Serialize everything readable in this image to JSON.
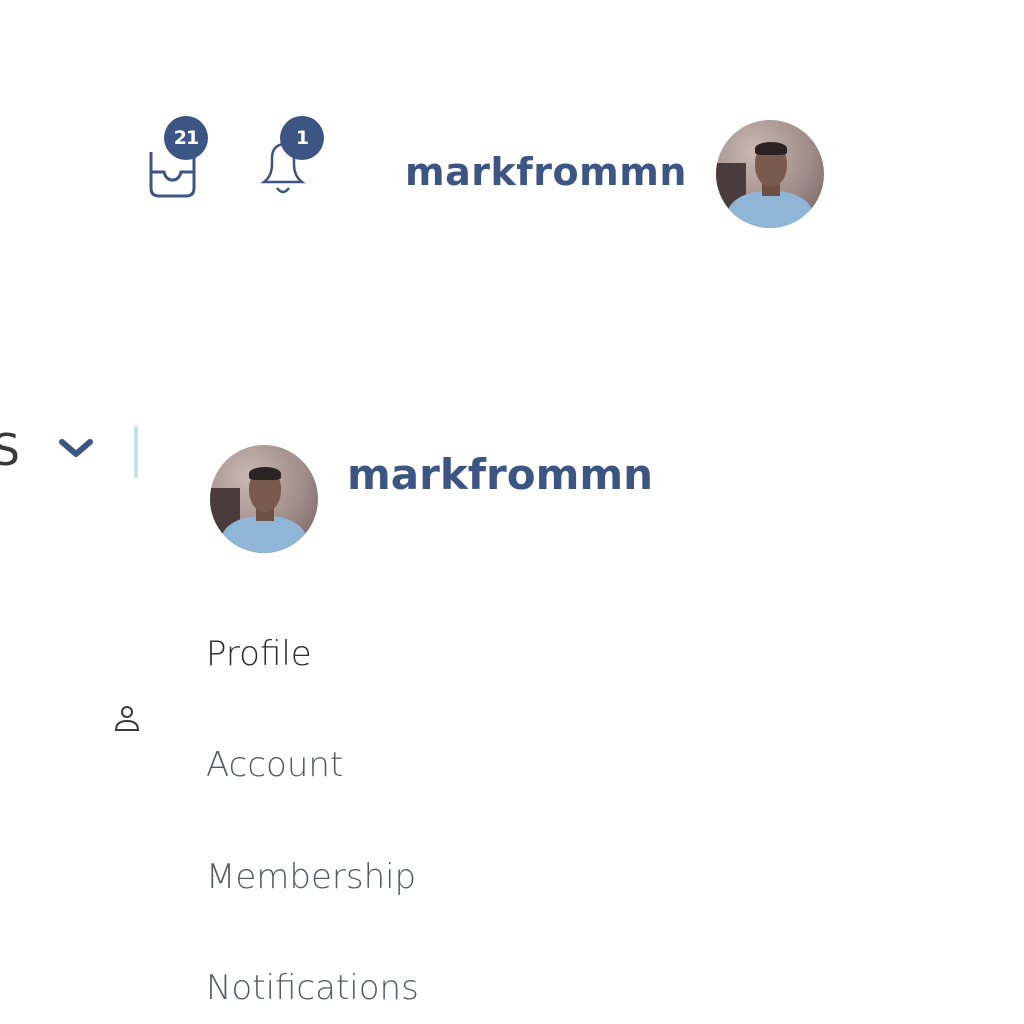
{
  "header": {
    "inbox": {
      "icon": "inbox-icon",
      "badge_count": "21"
    },
    "notifications": {
      "icon": "bell-icon",
      "badge_count": "1"
    },
    "username": "markfrommn",
    "avatar_icon": "user-avatar"
  },
  "nav": {
    "partial_label": "S",
    "chevron_icon": "chevron-down-icon",
    "user_icon": "user-icon"
  },
  "dropdown": {
    "username": "markfrommn",
    "items": [
      {
        "label": "Profile"
      },
      {
        "label": "Account"
      },
      {
        "label": "Membership"
      },
      {
        "label": "Notifications"
      }
    ]
  },
  "colors": {
    "accent": "#3d5582",
    "divider": "#bfe3f1",
    "text": "#2a2a2a",
    "background": "#ffffff"
  }
}
